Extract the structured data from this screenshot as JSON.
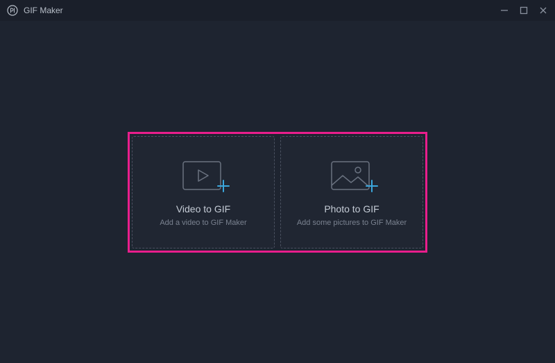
{
  "titlebar": {
    "app_title": "GIF Maker"
  },
  "options": {
    "video": {
      "title": "Video to GIF",
      "subtitle": "Add a video to GIF Maker"
    },
    "photo": {
      "title": "Photo to GIF",
      "subtitle": "Add some pictures to GIF Maker"
    }
  },
  "colors": {
    "accent": "#3ba7dd",
    "highlight": "#e91e8c",
    "background": "#1e2430"
  }
}
